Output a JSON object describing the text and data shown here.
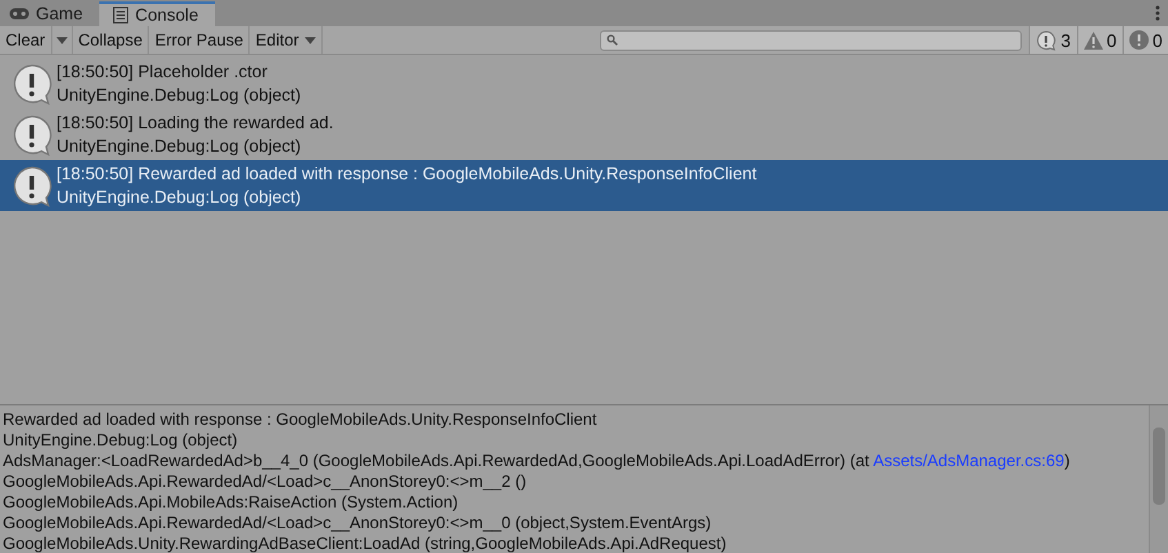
{
  "tabs": [
    {
      "label": "Game",
      "kind": "game",
      "selected": false
    },
    {
      "label": "Console",
      "kind": "console",
      "selected": true
    }
  ],
  "toolbar": {
    "buttons": [
      {
        "label": "Clear",
        "kind": "split"
      },
      {
        "label": "Collapse",
        "kind": "button"
      },
      {
        "label": "Error Pause",
        "kind": "button"
      },
      {
        "label": "Editor",
        "kind": "dropdown"
      }
    ],
    "counters": [
      {
        "kind": "info",
        "count": "3"
      },
      {
        "kind": "warning",
        "count": "0"
      },
      {
        "kind": "error",
        "count": "0"
      }
    ]
  },
  "entries": [
    {
      "message": "[18:50:50] Placeholder .ctor",
      "source": "UnityEngine.Debug:Log (object)",
      "selected": false
    },
    {
      "message": "[18:50:50] Loading the rewarded ad.",
      "source": "UnityEngine.Debug:Log (object)",
      "selected": false
    },
    {
      "message": "[18:50:50] Rewarded ad loaded with response : GoogleMobileAds.Unity.ResponseInfoClient",
      "source": "UnityEngine.Debug:Log (object)",
      "selected": true
    }
  ],
  "details": [
    {
      "text": "Rewarded ad loaded with response : GoogleMobileAds.Unity.ResponseInfoClient"
    },
    {
      "text": "UnityEngine.Debug:Log (object)"
    },
    {
      "text": "AdsManager:<LoadRewardedAd>b__4_0 (GoogleMobileAds.Api.RewardedAd,GoogleMobileAds.Api.LoadAdError) (at ",
      "link": "Assets/AdsManager.cs:69",
      "after": ")"
    },
    {
      "text": "GoogleMobileAds.Api.RewardedAd/<Load>c__AnonStorey0:<>m__2 ()"
    },
    {
      "text": "GoogleMobileAds.Api.MobileAds:RaiseAction (System.Action)"
    },
    {
      "text": "GoogleMobileAds.Api.RewardedAd/<Load>c__AnonStorey0:<>m__0 (object,System.EventArgs)"
    },
    {
      "text": "GoogleMobileAds.Unity.RewardingAdBaseClient:LoadAd (string,GoogleMobileAds.Api.AdRequest)"
    }
  ]
}
